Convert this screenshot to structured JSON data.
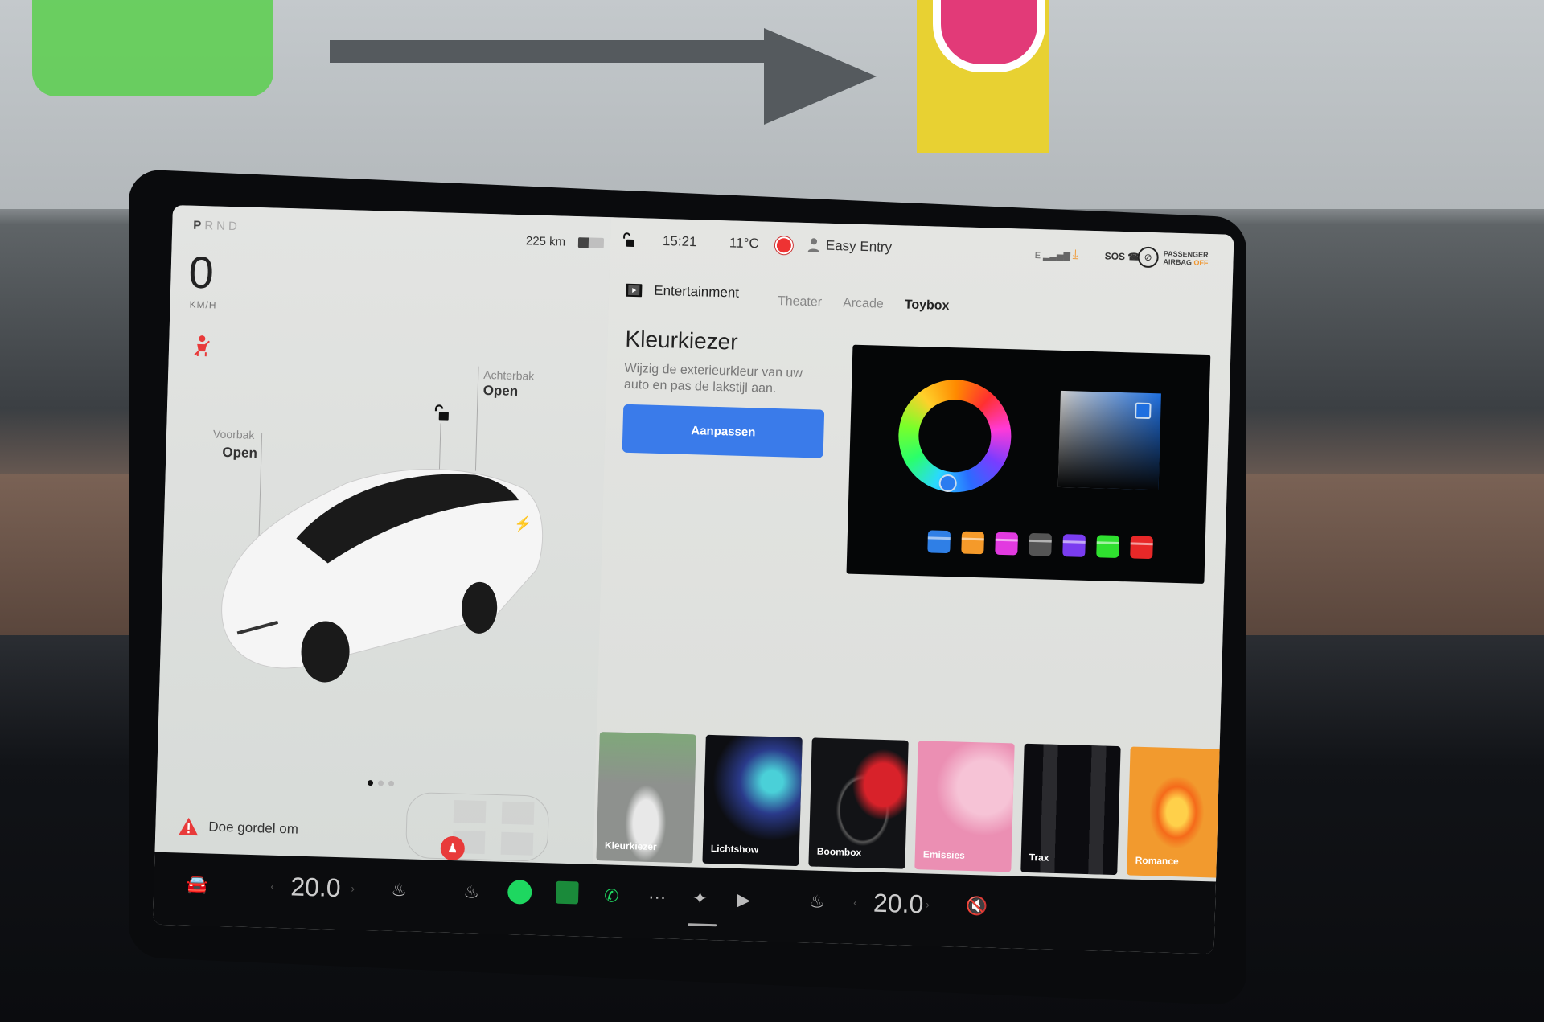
{
  "status_bar": {
    "gear": {
      "letters": [
        "P",
        "R",
        "N",
        "D"
      ],
      "selected": "P"
    },
    "range": "225 km",
    "battery_level": 0.4,
    "time": "15:21",
    "temperature": "11°C",
    "profile": "Easy Entry",
    "network": "E",
    "sos": "SOS",
    "airbag": {
      "line1": "PASSENGER",
      "line2": "AIRBAG",
      "state": "OFF"
    }
  },
  "left_panel": {
    "speed": "0",
    "speed_unit": "KM/H",
    "frunk": {
      "label": "Voorbak",
      "state": "Open"
    },
    "trunk": {
      "label": "Achterbak",
      "state": "Open"
    },
    "page_dots": 3,
    "active_dot": 0,
    "seatbelt_warning": "Doe gordel om"
  },
  "entertainment": {
    "header": "Entertainment",
    "tabs": [
      {
        "label": "Theater",
        "active": false
      },
      {
        "label": "Arcade",
        "active": false
      },
      {
        "label": "Toybox",
        "active": true
      }
    ],
    "feature": {
      "title": "Kleurkiezer",
      "description": "Wijzig de exterieurkleur van uw auto en pas de lakstijl aan.",
      "button": "Aanpassen"
    },
    "swatches": [
      "#2f7fe6",
      "#f59a2a",
      "#e23ae0",
      "#555555",
      "#7a3cf0",
      "#2fe02f",
      "#e82828"
    ],
    "tiles": [
      {
        "label": "Kleurkiezer",
        "bg": "#8e918e"
      },
      {
        "label": "Lichtshow",
        "bg": "#0d0e12"
      },
      {
        "label": "Boombox",
        "bg": "#121316"
      },
      {
        "label": "Emissies",
        "bg": "#eb8fb3"
      },
      {
        "label": "Trax",
        "bg": "#0c0c10"
      },
      {
        "label": "Romance",
        "bg": "#f29a2e"
      }
    ]
  },
  "taskbar": {
    "driver_temp": "20.0",
    "passenger_temp": "20.0",
    "icons": [
      "car-icon",
      "seat-heater-icon",
      "steering-heater-icon",
      "spotify-icon",
      "stocks-icon",
      "phone-icon",
      "more-icon",
      "toybox-icon",
      "theater-icon",
      "seat-heater-icon",
      "volume-mute-icon"
    ]
  },
  "colors": {
    "accent_blue": "#3a7bea",
    "alert_red": "#e83a3a",
    "spotify_green": "#1ed760"
  }
}
